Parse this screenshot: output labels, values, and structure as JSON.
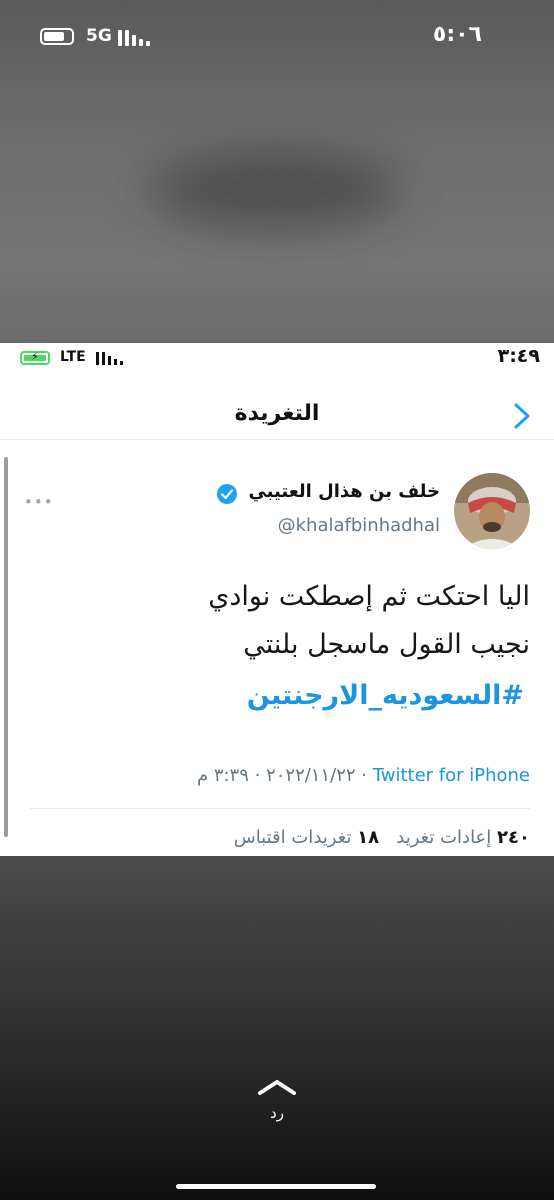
{
  "outer_status": {
    "network": "5G",
    "time": "٥:٠٦"
  },
  "inner_status": {
    "network": "LTE",
    "time": "٣:٤٩"
  },
  "nav": {
    "title": "التغريدة"
  },
  "tweet": {
    "author_name": "خلف بن هذال العتيبي",
    "handle": "@khalafbinhadhal",
    "more": "•••",
    "lines": [
      "اليا احتكت ثم إصطكت نوادي",
      "نجيب القول ماسجل بلنتي"
    ],
    "hashtag": "#السعوديه_الارجنتين",
    "date": "٢٠٢٢/١١/٢٢",
    "time": "٣:٣٩ م",
    "source": "Twitter for iPhone",
    "retweets_count": "٢٤٠",
    "retweets_label": "إعادات تغريد",
    "quotes_count": "١٨",
    "quotes_label": "تغريدات اقتباس"
  },
  "footer": {
    "reply_label": "رد"
  },
  "colors": {
    "link": "#1b95e0",
    "muted": "#657786",
    "verified": "#1da1f2"
  }
}
